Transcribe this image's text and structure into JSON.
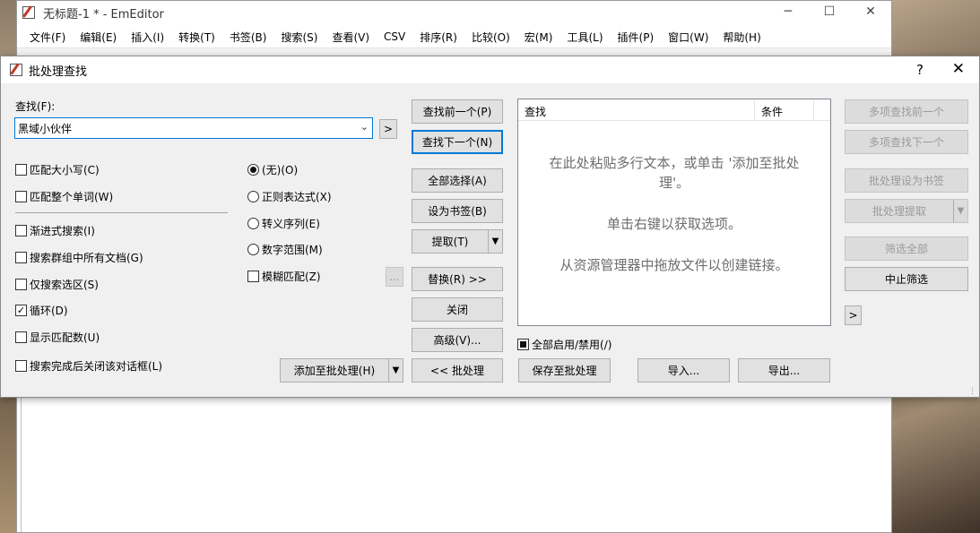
{
  "main_window": {
    "title": "无标题-1 * - EmEditor",
    "controls": [
      "─",
      "☐",
      "✕"
    ],
    "menus": [
      "文件(F)",
      "编辑(E)",
      "插入(I)",
      "转换(T)",
      "书签(B)",
      "搜索(S)",
      "查看(V)",
      "CSV",
      "排序(R)",
      "比较(O)",
      "宏(M)",
      "工具(L)",
      "插件(P)",
      "窗口(W)",
      "帮助(H)"
    ]
  },
  "dialog": {
    "title": "批处理查找",
    "help": "?",
    "close": "✕",
    "find_label": "查找(F):",
    "find_value": "黑域小伙伴",
    "expand_button": ">",
    "options_left": [
      {
        "label": "匹配大小写(C)",
        "checked": false
      },
      {
        "label": "匹配整个单词(W)",
        "checked": false
      },
      {
        "label": "渐进式搜索(I)",
        "checked": false
      },
      {
        "label": "搜索群组中所有文档(G)",
        "checked": false
      },
      {
        "label": "仅搜索选区(S)",
        "checked": false
      },
      {
        "label": "循环(D)",
        "checked": true
      },
      {
        "label": "显示匹配数(U)",
        "checked": false
      },
      {
        "label": "搜索完成后关闭该对话框(L)",
        "checked": false
      }
    ],
    "radio_options": [
      {
        "label": "(无)(O)",
        "selected": true
      },
      {
        "label": "正则表达式(X)",
        "selected": false
      },
      {
        "label": "转义序列(E)",
        "selected": false
      },
      {
        "label": "数字范围(M)",
        "selected": false
      }
    ],
    "fuzzy": {
      "label": "模糊匹配(Z)",
      "checked": false
    },
    "fuzzy_more": "...",
    "add_to_batch": "添加至批处理(H)",
    "center_buttons": {
      "find_prev": "查找前一个(P)",
      "find_next": "查找下一个(N)",
      "select_all": "全部选择(A)",
      "set_bookmark": "设为书签(B)",
      "extract": "提取(T)",
      "replace": "替换(R) >>",
      "close": "关闭",
      "advanced": "高级(V)...",
      "batch": "<< 批处理"
    },
    "list": {
      "col_find": "查找",
      "col_condition": "条件",
      "hint1": "在此处粘贴多行文本，或单击 '添加至批处",
      "hint1b": "理'。",
      "hint2": "单击右键以获取选项。",
      "hint3": "从资源管理器中拖放文件以创建链接。"
    },
    "enable_all": "全部启用/禁用(/)",
    "save_batch": "保存至批处理",
    "import": "导入...",
    "export": "导出...",
    "right_buttons": {
      "multi_prev": "多项查找前一个",
      "multi_next": "多项查找下一个",
      "batch_bookmark": "批处理设为书签",
      "batch_extract": "批处理提取",
      "filter_all": "筛选全部",
      "stop_filter": "中止筛选",
      "expand_right": ">"
    }
  }
}
